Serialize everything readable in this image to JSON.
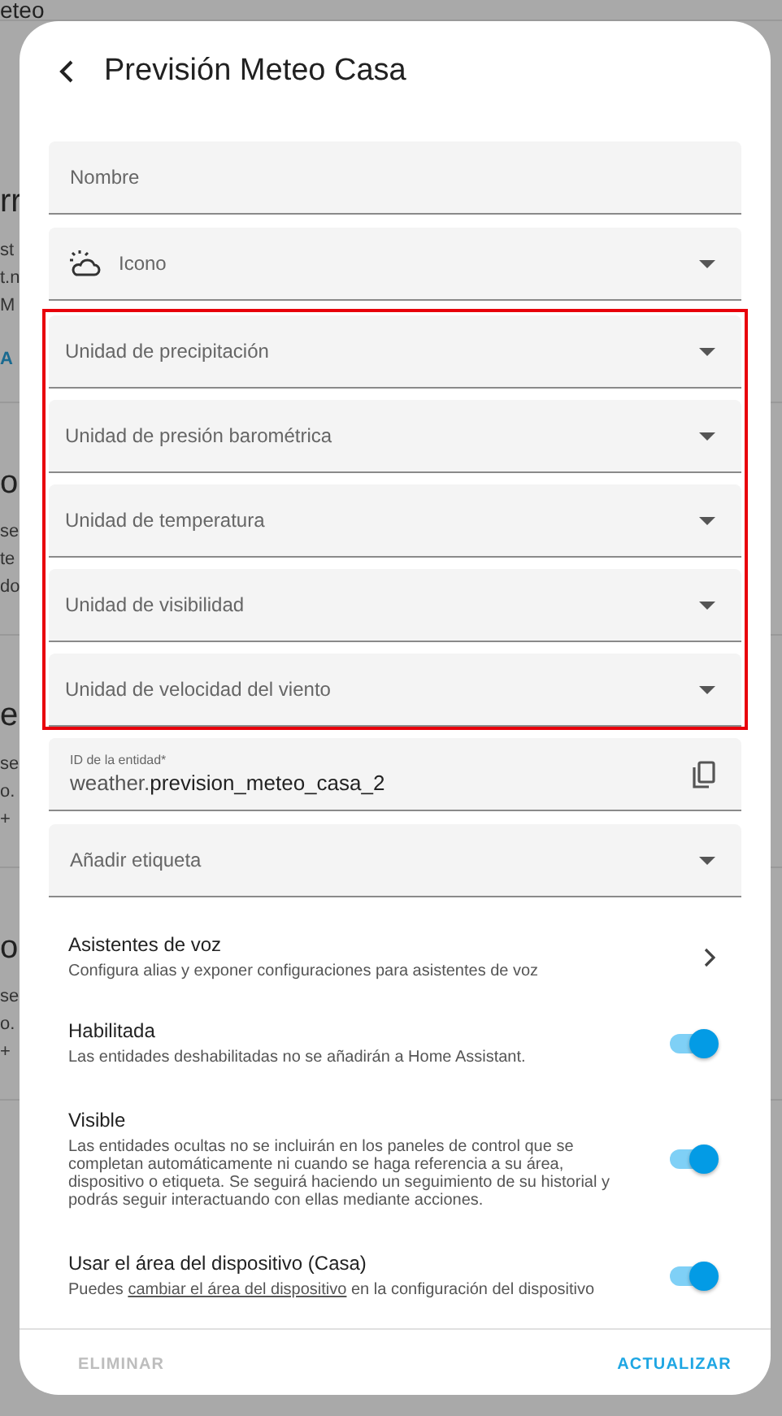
{
  "background": {
    "title": "eteo",
    "sections": [
      {
        "heading": "rr",
        "lines": [
          "st",
          "t.n",
          "M"
        ],
        "link": "A"
      },
      {
        "heading": "o",
        "lines": [
          "se",
          "te",
          "do"
        ]
      },
      {
        "heading": "e",
        "lines": [
          "se",
          "o.",
          "+"
        ]
      },
      {
        "heading": "o",
        "lines": [
          "se",
          "o.",
          "+"
        ]
      }
    ]
  },
  "dialog": {
    "title": "Previsión Meteo Casa",
    "name_field": {
      "placeholder": "Nombre"
    },
    "icon_field": {
      "label": "Icono"
    },
    "unit_fields": {
      "highlighted": true,
      "items": [
        {
          "label": "Unidad de precipitación"
        },
        {
          "label": "Unidad de presión barométrica"
        },
        {
          "label": "Unidad de temperatura"
        },
        {
          "label": "Unidad de visibilidad"
        },
        {
          "label": "Unidad de velocidad del viento"
        }
      ]
    },
    "entity_id": {
      "label": "ID de la entidad*",
      "prefix": "weather.",
      "value": "prevision_meteo_casa_2"
    },
    "label_field": {
      "label": "Añadir etiqueta"
    },
    "voice": {
      "title": "Asistentes de voz",
      "description": "Configura alias y exponer configuraciones para asistentes de voz"
    },
    "toggles": [
      {
        "title": "Habilitada",
        "description": "Las entidades deshabilitadas no se añadirán a Home Assistant.",
        "on": true
      },
      {
        "title": "Visible",
        "description": "Las entidades ocultas no se incluirán en los paneles de control que se completan automáticamente ni cuando se haga referencia a su área, dispositivo o etiqueta. Se seguirá haciendo un seguimiento de su historial y podrás seguir interactuando con ellas mediante acciones.",
        "on": true
      },
      {
        "title": "Usar el área del dispositivo (Casa)",
        "description_before": "Puedes ",
        "link": "cambiar el área del dispositivo",
        "description_after": " en la configuración del dispositivo",
        "on": true
      }
    ],
    "buttons": [
      {
        "label": "ELIMINAR",
        "disabled": true
      },
      {
        "label": "ACTUALIZAR",
        "disabled": false
      }
    ]
  }
}
